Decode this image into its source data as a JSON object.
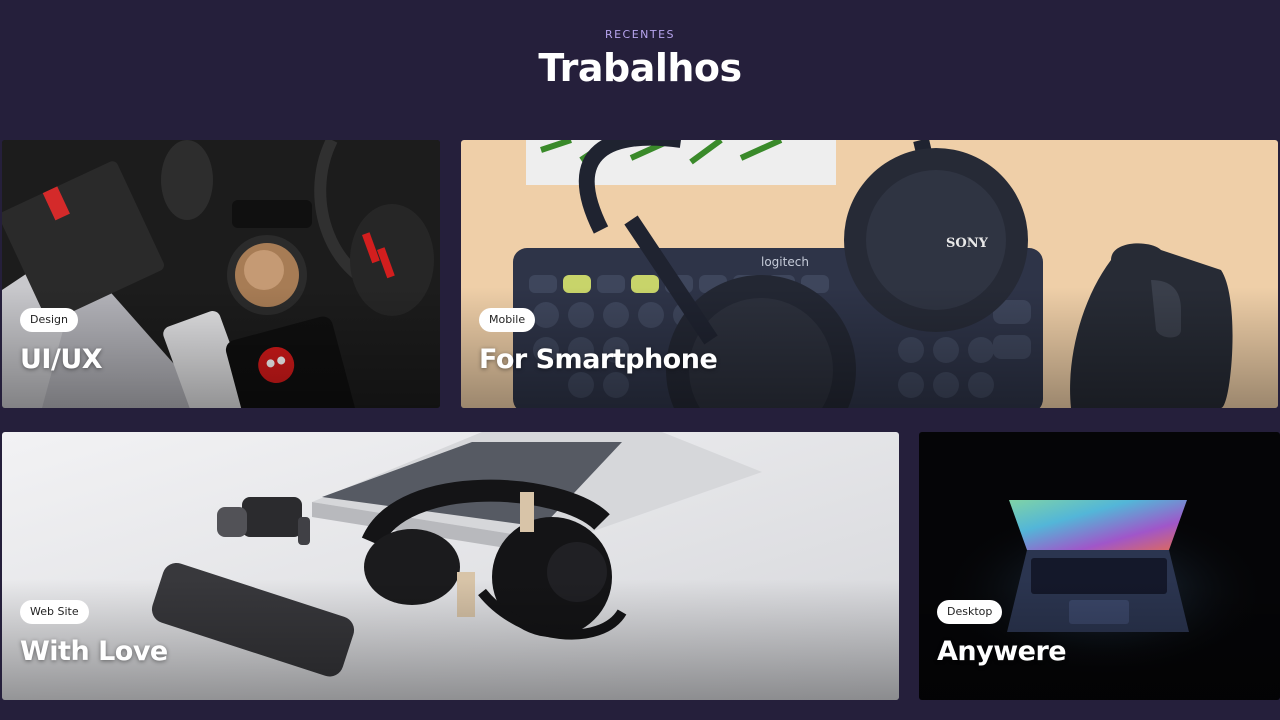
{
  "section": {
    "eyebrow": "RECENTES",
    "title": "Trabalhos"
  },
  "cards": [
    {
      "tag": "Design",
      "title": "UI/UX",
      "image": "flatlay-notebook-headphones-phone-coffee"
    },
    {
      "tag": "Mobile",
      "title": "For Smartphone",
      "image": "sony-headphones-logitech-keyboard-mouse",
      "image_text": {
        "brand_keyboard": "logitech",
        "brand_headphones": "SONY"
      }
    },
    {
      "tag": "Web Site",
      "title": "With Love",
      "image": "laptop-headphones-watch-phone-white-desk"
    },
    {
      "tag": "Desktop",
      "title": "Anywere",
      "image": "glowing-laptop-dark"
    }
  ],
  "colors": {
    "background": "#251f3b",
    "eyebrow": "#b7a4ee",
    "tag_bg": "#ffffff"
  }
}
